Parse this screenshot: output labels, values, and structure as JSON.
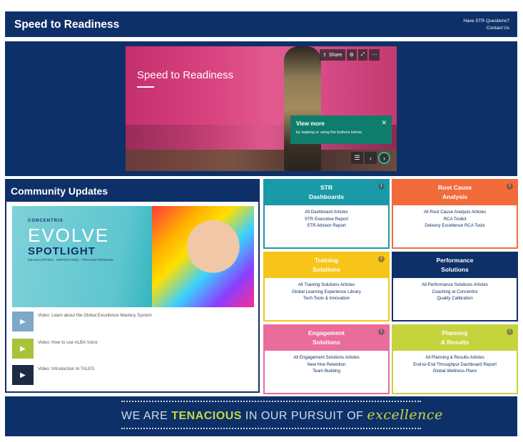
{
  "header": {
    "title": "Speed to Readiness",
    "help_line1": "Have STR Questions?",
    "help_line2": "Contact Us"
  },
  "hero": {
    "slide_title": "Speed to Readiness",
    "toolbar": {
      "share_label": "Share",
      "share_icon": "share-icon",
      "settings_icon": "gear-icon",
      "expand_icon": "expand-icon",
      "more_icon": "more-icon"
    },
    "tooltip": {
      "title": "View more",
      "text": "by swiping or using the buttons below."
    }
  },
  "community": {
    "title": "Community Updates",
    "banner": {
      "brand": "CONCENTRIX",
      "word1": "EVOLVE",
      "word2": "SPOTLIGHT",
      "tagline": "DEVELOPING. IMPROVING. TRANSFORMING."
    },
    "videos": [
      {
        "label": "Video: Learn about the Global Excellence Mastery System",
        "color": "#7fa7c8"
      },
      {
        "label": "Video: How to use ALBA Voice",
        "color": "#a8c23a"
      },
      {
        "label": "Video: Introduction to TALES",
        "color": "#1c2a44"
      }
    ]
  },
  "tiles": [
    {
      "title1": "STR",
      "title2": "Dashboards",
      "color": "#1a9aa6",
      "links": [
        "All Dashboard Articles",
        "STR Executive Report",
        "STR Advisor Report"
      ]
    },
    {
      "title1": "Root Cause",
      "title2": "Analysis",
      "color": "#f26b3a",
      "links": [
        "All Root Cause Analysis Articles",
        "RCA Toolkit",
        "Delivery Excellence RCA Tools"
      ]
    },
    {
      "title1": "Training",
      "title2": "Solutions",
      "color": "#f7c51a",
      "links": [
        "All Training Solutions Articles",
        "Global Learning Experience Library",
        "Tech Tools & Innovation"
      ]
    },
    {
      "title1": "Performance",
      "title2": "Solutions",
      "color": "#0e3068",
      "links": [
        "All Performance Solutions Articles",
        "Coaching at Concentrix",
        "Quality Calibration"
      ]
    },
    {
      "title1": "Engagement",
      "title2": "Solutions",
      "color": "#e96c9b",
      "links": [
        "All Engagement Solutions Articles",
        "New Hire Retention",
        "Team Building"
      ]
    },
    {
      "title1": "Planning",
      "title2": "& Results",
      "color": "#c5d43d",
      "links": [
        "All Planning & Results Articles",
        "End-to-End Throughput Dashboard Report",
        "Global Wellness Plans"
      ]
    }
  ],
  "footer": {
    "part1": "WE ARE ",
    "emphasis": "TENACIOUS",
    "part2": " IN OUR PURSUIT OF ",
    "script": "excellence"
  }
}
